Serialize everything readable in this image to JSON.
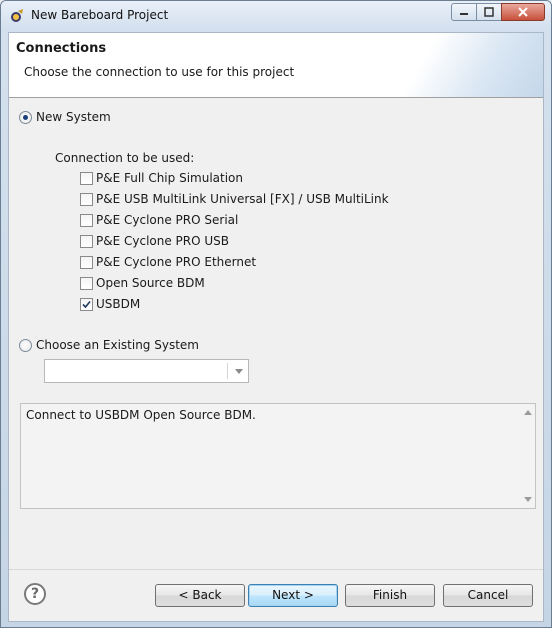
{
  "window": {
    "title": "New Bareboard Project",
    "icon": "eclipse-wizard-icon"
  },
  "header": {
    "title": "Connections",
    "description": "Choose the connection to use for this project"
  },
  "new_system": {
    "label": "New System",
    "selected": true
  },
  "connections": {
    "label": "Connection to be used:",
    "items": [
      {
        "label": "P&E Full Chip Simulation",
        "checked": false
      },
      {
        "label": "P&E USB MultiLink Universal [FX] / USB MultiLink",
        "checked": false
      },
      {
        "label": "P&E Cyclone PRO Serial",
        "checked": false
      },
      {
        "label": "P&E Cyclone PRO USB",
        "checked": false
      },
      {
        "label": "P&E Cyclone PRO Ethernet",
        "checked": false
      },
      {
        "label": "Open Source BDM",
        "checked": false
      },
      {
        "label": "USBDM",
        "checked": true
      }
    ]
  },
  "existing_system": {
    "label": "Choose an Existing System",
    "selected": false,
    "value": ""
  },
  "description_box": {
    "text": "Connect to USBDM Open Source BDM."
  },
  "buttons": {
    "back": "< Back",
    "next": "Next >",
    "finish": "Finish",
    "cancel": "Cancel"
  }
}
